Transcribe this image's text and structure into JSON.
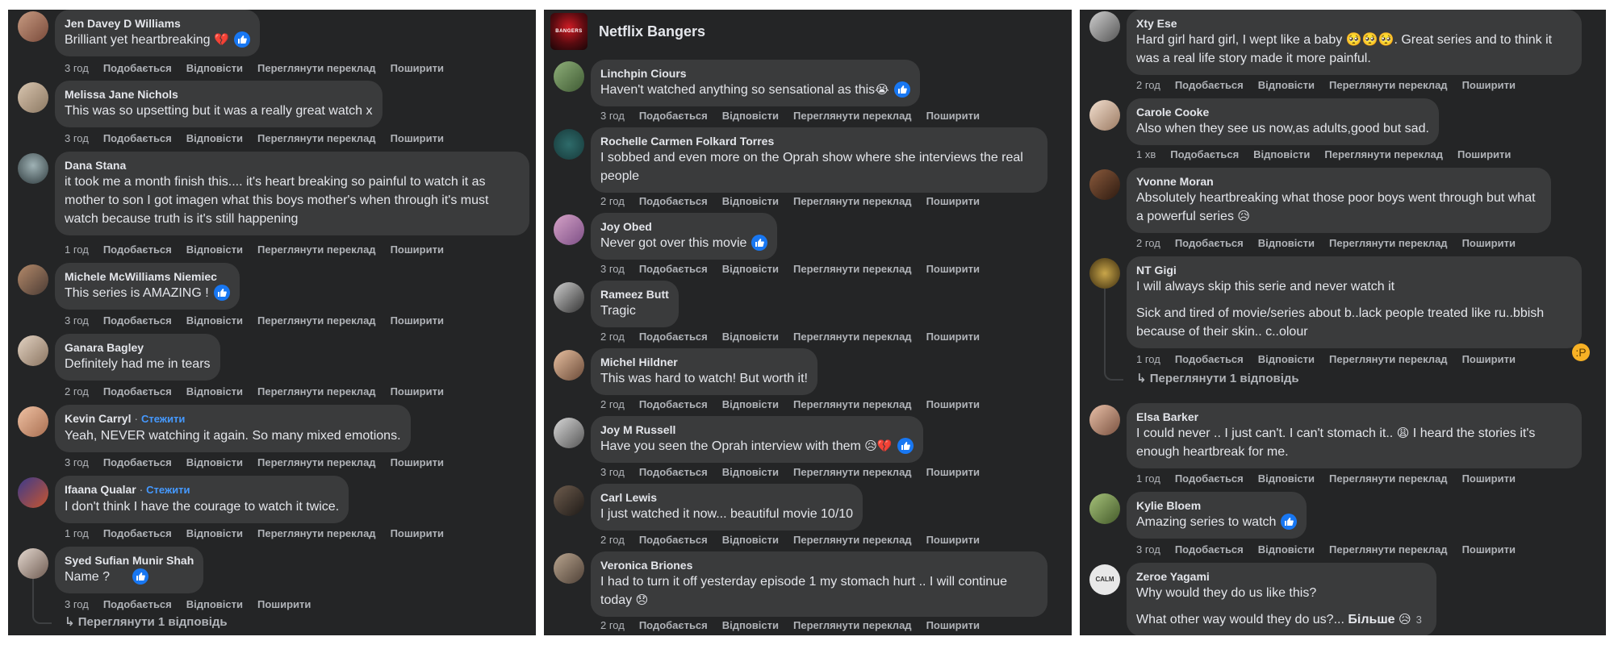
{
  "actions": {
    "like": "Подобається",
    "reply": "Відповісти",
    "translate": "Переглянути переклад",
    "share": "Поширити"
  },
  "panel1": {
    "comments": [
      {
        "author": "Jen Davey D Williams",
        "text": "Brilliant yet heartbreaking",
        "emoji": "💔",
        "time": "3 год"
      },
      {
        "author": "Melissa Jane Nichols",
        "text": "This was so upsetting but it was a really great watch x",
        "time": "3 год"
      },
      {
        "author": "Dana Stana",
        "text": "it took me a month finish this.... it's heart breaking so painful to watch it as mother to son I got imagen what this boys mother's when through it's must watch because truth is it's still happening",
        "time": "1 год"
      },
      {
        "author": "Michele McWilliams Niemiec",
        "text": "This series is AMAZING !",
        "time": "3 год"
      },
      {
        "author": "Ganara Bagley",
        "text": "Definitely had me in tears",
        "time": "2 год"
      },
      {
        "author": "Kevin Carryl",
        "follow": "Стежити",
        "text": "Yeah, NEVER watching it again. So many mixed emotions.",
        "time": "3 год"
      },
      {
        "author": "Ifaana Qualar",
        "follow": "Стежити",
        "text": "I don't think I have the courage to watch it twice.",
        "time": "1 год"
      },
      {
        "author": "Syed Sufian Munir Shah",
        "text": "Name ?",
        "time": "3 год"
      }
    ],
    "replies": "↳ Переглянути 1 відповідь"
  },
  "panel2": {
    "page_name": "Netflix Bangers",
    "logo_text": "BANGERS",
    "comments": [
      {
        "author": "Linchpin Ciours",
        "text": "Haven't watched anything so sensational as this",
        "emoji": "😭",
        "time": "3 год"
      },
      {
        "author": "Rochelle Carmen Folkard Torres",
        "text": "I sobbed and even more on the Oprah show where she interviews the real people",
        "time": "2 год"
      },
      {
        "author": "Joy Obed",
        "text": "Never got over this movie",
        "time": "3 год"
      },
      {
        "author": "Rameez Butt",
        "text": "Tragic",
        "time": "2 год"
      },
      {
        "author": "Michel Hildner",
        "text": "This was hard to watch! But worth it!",
        "time": "2 год"
      },
      {
        "author": "Joy M Russell",
        "text": "Have you seen the Oprah interview with them",
        "emoji": "😥💔",
        "time": "3 год"
      },
      {
        "author": "Carl Lewis",
        "text": "I just watched it now... beautiful movie 10/10",
        "time": "2 год"
      },
      {
        "author": "Veronica Briones",
        "text": "I had to turn it off yesterday episode 1 my stomach hurt .. I will continue today",
        "emoji": "😞",
        "time": "2 год"
      }
    ]
  },
  "panel3": {
    "comments": [
      {
        "author": "Xty Ese",
        "text": "Hard girl hard girl, I wept like a baby 🥺🥺🥺. Great series and to think it was a real life story made it more painful.",
        "time": "2 год"
      },
      {
        "author": "Carole Cooke",
        "text": "Also when they see us now,as adults,good but sad.",
        "time": "1 хв"
      },
      {
        "author": "Yvonne Moran",
        "text": "Absolutely heartbreaking what those poor boys went through but what a powerful series",
        "emoji": "😥",
        "time": "2 год"
      },
      {
        "author": "NT Gigi",
        "text": "I will always skip this serie and never watch it",
        "text2": "Sick and tired of movie/series about b..lack people treated like ru..bbish because of their skin.. c..olour",
        "time": "1 год"
      },
      {
        "author": "Elsa Barker",
        "text": "I could never .. I just can't. I can't stomach it..",
        "emoji": "😩",
        "text_after": "I heard the stories it's enough heartbreak for me.",
        "time": "1 год"
      },
      {
        "author": "Kylie Bloem",
        "text": "Amazing series to watch",
        "time": "3 год"
      },
      {
        "author": "Zeroe Yagami",
        "text": "Why would they do us like this?",
        "text2": "What other way would they do us?...",
        "more": "Більше",
        "react_count": "3"
      }
    ],
    "replies": "↳ Переглянути 1 відповідь"
  }
}
